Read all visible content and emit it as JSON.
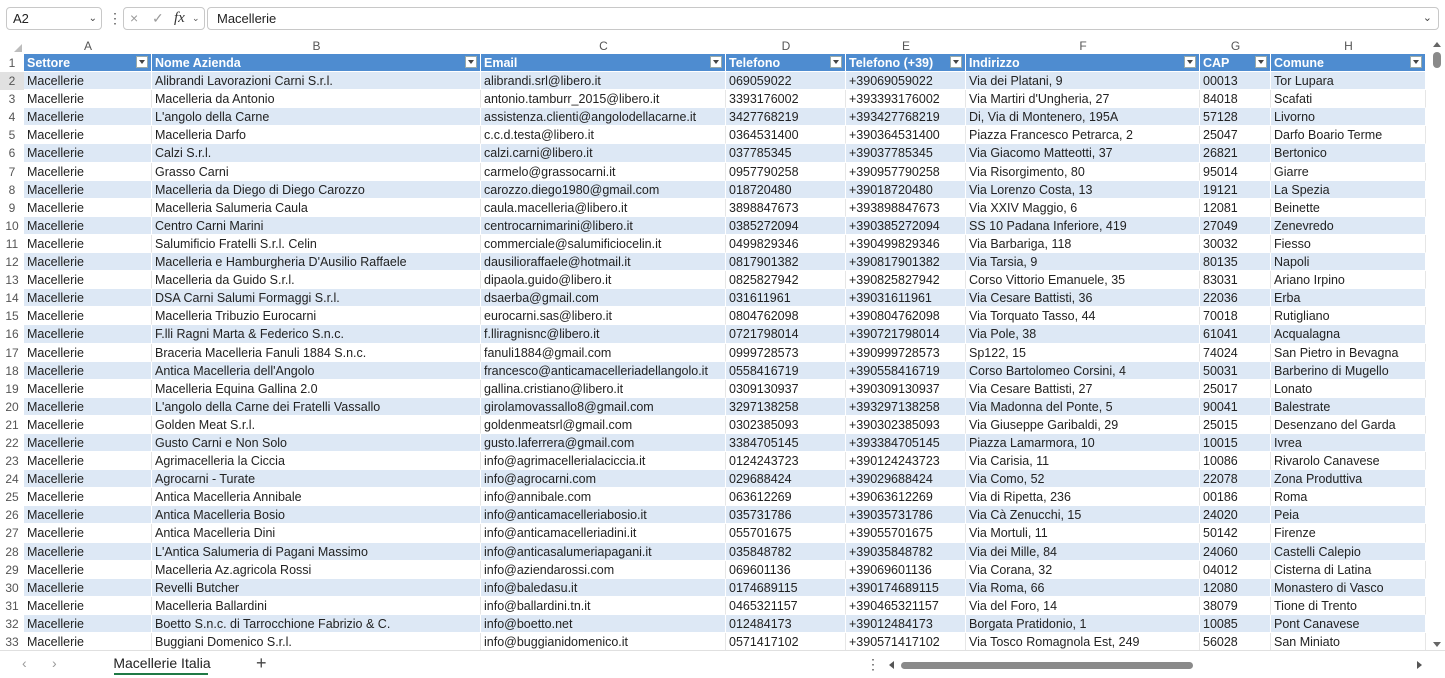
{
  "formula_bar": {
    "name_box": "A2",
    "cancel_icon": "×",
    "confirm_icon": "✓",
    "fx_label": "fx",
    "value": "Macellerie"
  },
  "columns": [
    "A",
    "B",
    "C",
    "D",
    "E",
    "F",
    "G",
    "H"
  ],
  "headers": [
    "Settore",
    "Nome Azienda",
    "Email",
    "Telefono",
    "Telefono (+39)",
    "Indirizzo",
    "CAP",
    "Comune"
  ],
  "rows": [
    [
      "2",
      "Macellerie",
      "Alibrandi Lavorazioni Carni S.r.l.",
      "alibrandi.srl@libero.it",
      "069059022",
      "+39069059022",
      "Via dei Platani, 9",
      "00013",
      "Tor Lupara"
    ],
    [
      "3",
      "Macellerie",
      "Macelleria da Antonio",
      "antonio.tamburr_2015@libero.it",
      "3393176002",
      "+393393176002",
      "Via Martiri d'Ungheria, 27",
      "84018",
      "Scafati"
    ],
    [
      "4",
      "Macellerie",
      "L'angolo della Carne",
      "assistenza.clienti@angolodellacarne.it",
      "3427768219",
      "+393427768219",
      "Di, Via di Montenero, 195A",
      "57128",
      "Livorno"
    ],
    [
      "5",
      "Macellerie",
      "Macelleria Darfo",
      "c.c.d.testa@libero.it",
      "0364531400",
      "+390364531400",
      "Piazza Francesco Petrarca, 2",
      "25047",
      "Darfo Boario Terme"
    ],
    [
      "6",
      "Macellerie",
      "Calzi S.r.l.",
      "calzi.carni@libero.it",
      "037785345",
      "+39037785345",
      "Via Giacomo Matteotti, 37",
      "26821",
      "Bertonico"
    ],
    [
      "7",
      "Macellerie",
      "Grasso Carni",
      "carmelo@grassocarni.it",
      "0957790258",
      "+390957790258",
      "Via Risorgimento, 80",
      "95014",
      "Giarre"
    ],
    [
      "8",
      "Macellerie",
      "Macelleria da Diego di Diego Carozzo",
      "carozzo.diego1980@gmail.com",
      "018720480",
      "+39018720480",
      "Via Lorenzo Costa, 13",
      "19121",
      "La Spezia"
    ],
    [
      "9",
      "Macellerie",
      "Macelleria Salumeria Caula",
      "caula.macelleria@libero.it",
      "3898847673",
      "+393898847673",
      "Via XXIV Maggio, 6",
      "12081",
      "Beinette"
    ],
    [
      "10",
      "Macellerie",
      "Centro Carni Marini",
      "centrocarnimarini@libero.it",
      "0385272094",
      "+390385272094",
      "SS 10 Padana Inferiore, 419",
      "27049",
      "Zenevredo"
    ],
    [
      "11",
      "Macellerie",
      "Salumificio Fratelli S.r.l. Celin",
      "commerciale@salumificiocelin.it",
      "0499829346",
      "+390499829346",
      "Via Barbariga, 118",
      "30032",
      "Fiesso"
    ],
    [
      "12",
      "Macellerie",
      "Macelleria e Hamburgheria D'Ausilio Raffaele",
      "dausilioraffaele@hotmail.it",
      "0817901382",
      "+390817901382",
      "Via Tarsia, 9",
      "80135",
      "Napoli"
    ],
    [
      "13",
      "Macellerie",
      "Macelleria da Guido S.r.l.",
      "dipaola.guido@libero.it",
      "0825827942",
      "+390825827942",
      "Corso Vittorio Emanuele, 35",
      "83031",
      "Ariano Irpino"
    ],
    [
      "14",
      "Macellerie",
      "DSA Carni Salumi Formaggi S.r.l.",
      "dsaerba@gmail.com",
      "031611961",
      "+39031611961",
      "Via Cesare Battisti, 36",
      "22036",
      "Erba"
    ],
    [
      "15",
      "Macellerie",
      "Macelleria Tribuzio Eurocarni",
      "eurocarni.sas@libero.it",
      "0804762098",
      "+390804762098",
      "Via Torquato Tasso, 44",
      "70018",
      "Rutigliano"
    ],
    [
      "16",
      "Macellerie",
      "F.lli Ragni Marta & Federico S.n.c.",
      "f.lliragnisnc@libero.it",
      "0721798014",
      "+390721798014",
      "Via Pole, 38",
      "61041",
      "Acqualagna"
    ],
    [
      "17",
      "Macellerie",
      "Braceria Macelleria Fanuli 1884 S.n.c.",
      "fanuli1884@gmail.com",
      "0999728573",
      "+390999728573",
      "Sp122, 15",
      "74024",
      "San Pietro in Bevagna"
    ],
    [
      "18",
      "Macellerie",
      "Antica Macelleria dell'Angolo",
      "francesco@anticamacelleriadellangolo.it",
      "0558416719",
      "+390558416719",
      "Corso Bartolomeo Corsini, 4",
      "50031",
      "Barberino di Mugello"
    ],
    [
      "19",
      "Macellerie",
      "Macelleria Equina Gallina 2.0",
      "gallina.cristiano@libero.it",
      "0309130937",
      "+390309130937",
      "Via Cesare Battisti, 27",
      "25017",
      "Lonato"
    ],
    [
      "20",
      "Macellerie",
      "L'angolo della Carne dei Fratelli Vassallo",
      "girolamovassallo8@gmail.com",
      "3297138258",
      "+393297138258",
      "Via Madonna del Ponte, 5",
      "90041",
      "Balestrate"
    ],
    [
      "21",
      "Macellerie",
      "Golden Meat S.r.l.",
      "goldenmeatsrl@gmail.com",
      "0302385093",
      "+390302385093",
      "Via Giuseppe Garibaldi, 29",
      "25015",
      "Desenzano del Garda"
    ],
    [
      "22",
      "Macellerie",
      "Gusto Carni e Non Solo",
      "gusto.laferrera@gmail.com",
      "3384705145",
      "+393384705145",
      "Piazza Lamarmora, 10",
      "10015",
      "Ivrea"
    ],
    [
      "23",
      "Macellerie",
      "Agrimacelleria la Ciccia",
      "info@agrimacellerialaciccia.it",
      "0124243723",
      "+390124243723",
      "Via Carisia, 11",
      "10086",
      "Rivarolo Canavese"
    ],
    [
      "24",
      "Macellerie",
      "Agrocarni - Turate",
      "info@agrocarni.com",
      "029688424",
      "+39029688424",
      "Via Como, 52",
      "22078",
      "Zona Produttiva"
    ],
    [
      "25",
      "Macellerie",
      "Antica Macelleria Annibale",
      "info@annibale.com",
      "063612269",
      "+39063612269",
      "Via di Ripetta, 236",
      "00186",
      "Roma"
    ],
    [
      "26",
      "Macellerie",
      "Antica Macelleria Bosio",
      "info@anticamacelleriabosio.it",
      "035731786",
      "+39035731786",
      "Via Cà Zenucchi, 15",
      "24020",
      "Peia"
    ],
    [
      "27",
      "Macellerie",
      "Antica Macelleria Dini",
      "info@anticamacelleriadini.it",
      "055701675",
      "+39055701675",
      "Via Mortuli, 11",
      "50142",
      "Firenze"
    ],
    [
      "28",
      "Macellerie",
      "L'Antica Salumeria di Pagani Massimo",
      "info@anticasalumeriapagani.it",
      "035848782",
      "+39035848782",
      "Via dei Mille, 84",
      "24060",
      "Castelli Calepio"
    ],
    [
      "29",
      "Macellerie",
      "Macelleria Az.agricola Rossi",
      "info@aziendarossi.com",
      "069601136",
      "+39069601136",
      "Via Corana, 32",
      "04012",
      "Cisterna di Latina"
    ],
    [
      "30",
      "Macellerie",
      "Revelli Butcher",
      "info@baledasu.it",
      "0174689115",
      "+390174689115",
      "Via Roma, 66",
      "12080",
      "Monastero di Vasco"
    ],
    [
      "31",
      "Macellerie",
      "Macelleria Ballardini",
      "info@ballardini.tn.it",
      "0465321157",
      "+390465321157",
      "Via del Foro, 14",
      "38079",
      "Tione di Trento"
    ],
    [
      "32",
      "Macellerie",
      "Boetto S.n.c. di Tarrocchione Fabrizio & C.",
      "info@boetto.net",
      "012484173",
      "+39012484173",
      "Borgata Pratidonio, 1",
      "10085",
      "Pont Canavese"
    ],
    [
      "33",
      "Macellerie",
      "Buggiani Domenico S.r.l.",
      "info@buggianidomenico.it",
      "0571417102",
      "+390571417102",
      "Via Tosco Romagnola Est, 249",
      "56028",
      "San Miniato"
    ]
  ],
  "sheet_tabs": [
    "Macellerie Italia"
  ],
  "add_sheet": "+",
  "nav": {
    "prev": "‹",
    "next": "›"
  },
  "colors": {
    "header_bg": "#4e8cd0",
    "band_bg": "#dde8f5",
    "tab_accent": "#1f7a45"
  }
}
